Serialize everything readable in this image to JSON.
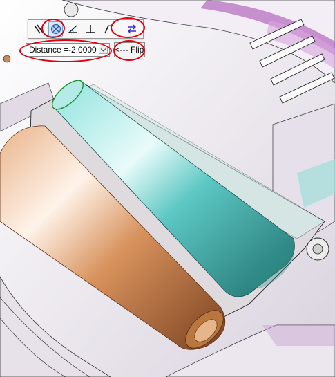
{
  "toolbar": {
    "buttons": [
      {
        "icon": "parallel-icon",
        "active": false
      },
      {
        "icon": "coincident-icon",
        "active": true
      },
      {
        "icon": "angle-icon",
        "active": false
      },
      {
        "icon": "perpendicular-icon",
        "active": false
      },
      {
        "icon": "tangent-icon",
        "active": false
      }
    ],
    "flip_direction_icon": "flip-direction-icon"
  },
  "distance": {
    "label": "Distance = ",
    "value": "-2.0000"
  },
  "flip_button": {
    "label": "<--- Flip"
  },
  "colors": {
    "highlight": "#e0000f",
    "copper_cylinder": "#c98852",
    "teal_cylinder": "#3fb6b2",
    "housing": "#eae4ee",
    "housing_purple": "#a34fb0"
  }
}
